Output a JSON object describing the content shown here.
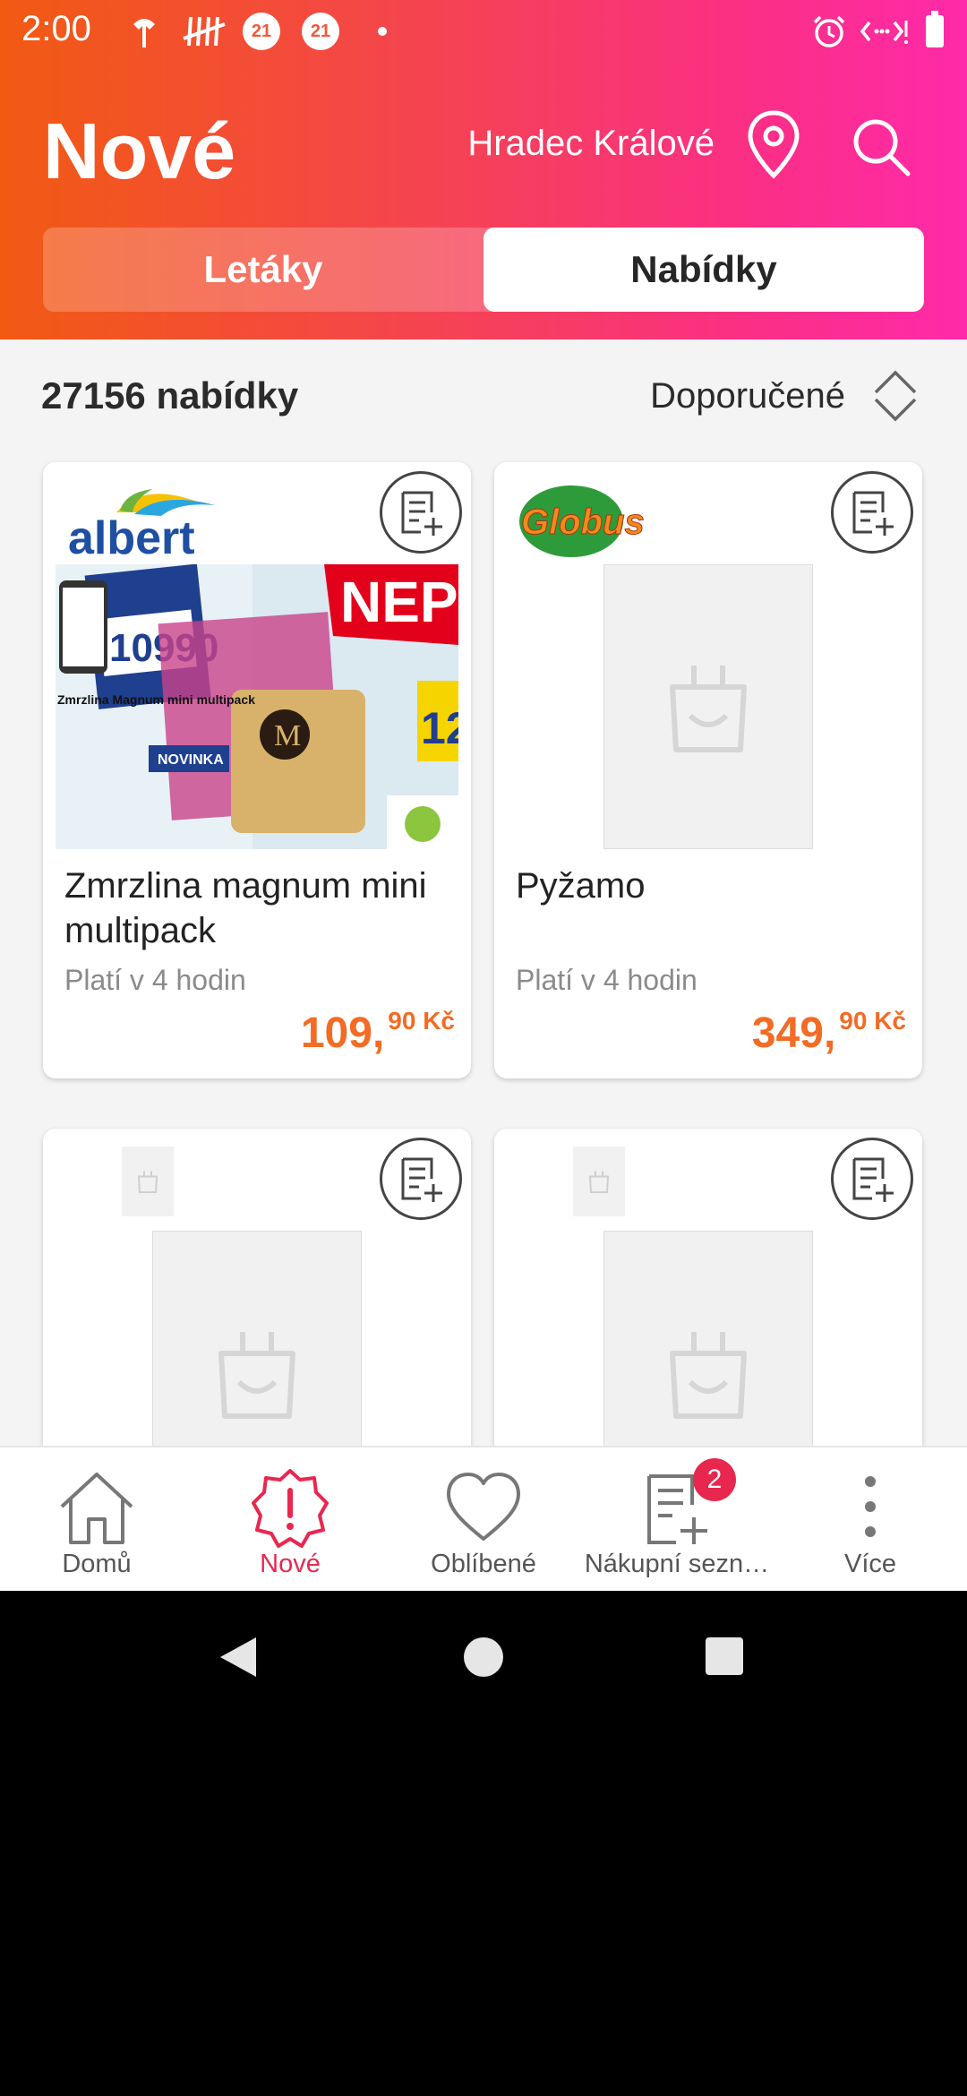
{
  "status_bar": {
    "time": "2:00",
    "badge1": "21",
    "badge2": "21"
  },
  "header": {
    "title": "Nové",
    "location": "Hradec Králové"
  },
  "segments": {
    "left": "Letáky",
    "right": "Nabídky",
    "selected": "Nabídky"
  },
  "list": {
    "count_label": "27156 nabídky",
    "sort_label": "Doporučené"
  },
  "cards": [
    {
      "store": "albert",
      "name": "Zmrzlina magnum mini multipack",
      "validity": "Platí v 4 hodin",
      "price_main": "109,",
      "price_decimal": "90 Kč",
      "image_texts": {
        "price": "10990",
        "product": "Zmrzlina Magnum mini multipack",
        "tag": "NOVINKA",
        "banner": "NEP",
        "side_price": "12"
      }
    },
    {
      "store": "Globus",
      "name": "Pyžamo",
      "validity": "Platí v 4 hodin",
      "price_main": "349,",
      "price_decimal": "90 Kč"
    },
    {
      "store": "",
      "name": "",
      "validity": ""
    },
    {
      "store": "",
      "name": "",
      "validity": ""
    }
  ],
  "bottom_nav": [
    {
      "label": "Domů",
      "icon": "home-icon"
    },
    {
      "label": "Nové",
      "icon": "new-icon",
      "active": true
    },
    {
      "label": "Oblíbené",
      "icon": "heart-icon"
    },
    {
      "label": "Nákupní sezn…",
      "icon": "shopping-list-icon",
      "badge": "2"
    },
    {
      "label": "Více",
      "icon": "more-icon"
    }
  ],
  "colors": {
    "accent": "#f36b24",
    "active_nav": "#e8274f",
    "gradient_start": "#f25a12",
    "gradient_end": "#ff2aa9"
  }
}
